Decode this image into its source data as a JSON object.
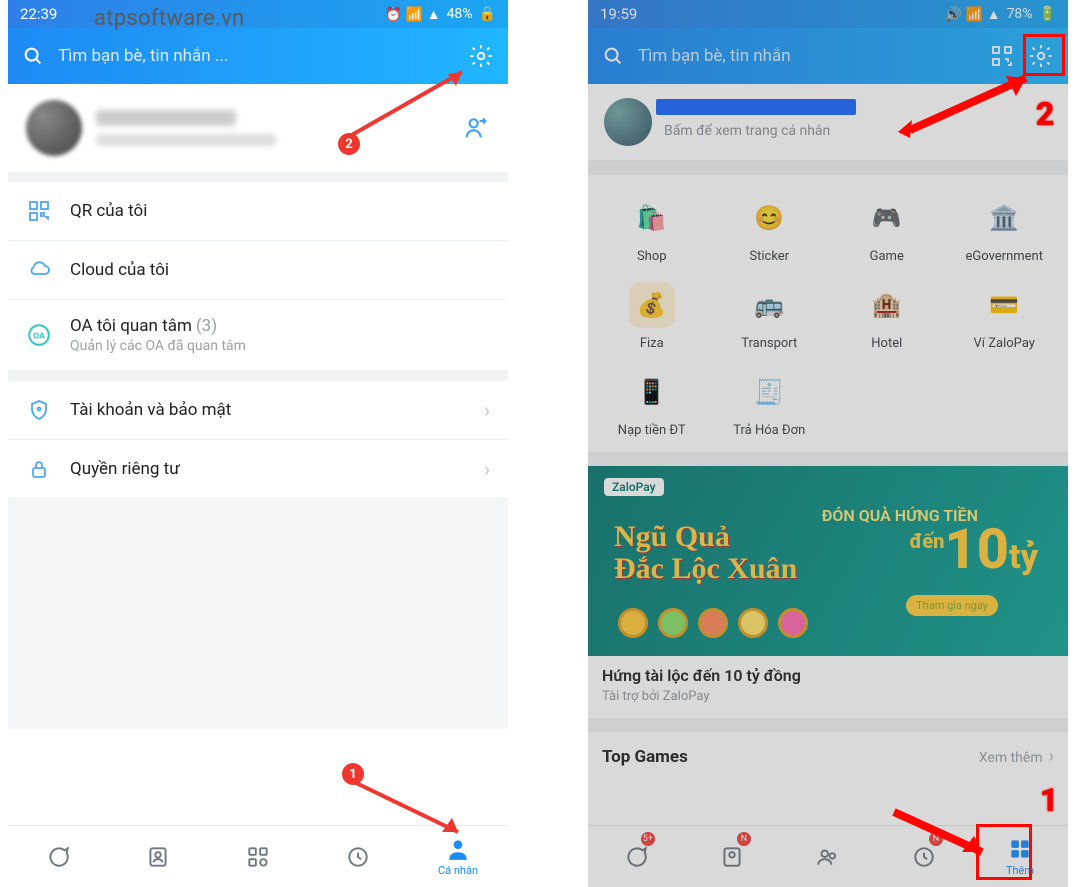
{
  "watermark": "atpsoftware.vn",
  "left": {
    "status": {
      "time": "22:39",
      "battery": "48%"
    },
    "header": {
      "placeholder": "Tìm bạn bè, tin nhắn ..."
    },
    "menu": {
      "qr": "QR của tôi",
      "cloud": "Cloud của tôi",
      "oa": "OA tôi quan tâm",
      "oa_count": "(3)",
      "oa_sub": "Quản lý các OA đã quan tâm",
      "account": "Tài khoản và bảo mật",
      "privacy": "Quyền riêng tư"
    },
    "nav": {
      "personal": "Cá nhân"
    },
    "markers": {
      "m1": "1",
      "m2": "2"
    }
  },
  "right": {
    "status": {
      "time": "19:59",
      "battery": "78%"
    },
    "header": {
      "placeholder": "Tìm bạn bè, tin nhắn"
    },
    "profile_sub": "Bấm để xem trang cá nhân",
    "grid": {
      "shop": "Shop",
      "sticker": "Sticker",
      "game": "Game",
      "egov": "eGovernment",
      "fiza": "Fiza",
      "transport": "Transport",
      "hotel": "Hotel",
      "zalopay": "Ví ZaloPay",
      "topup": "Nạp tiền ĐT",
      "bill": "Trả Hóa Đơn"
    },
    "banner": {
      "brand": "ZaloPay",
      "line1": "Ngũ Quả",
      "line2": "Đắc Lộc Xuân",
      "right_small": "ĐÓN QUÀ HỨNG TIỀN",
      "den": "đến",
      "amount": "10",
      "unit": "tỷ",
      "cta": "Tham gia ngay"
    },
    "promo": {
      "title": "Hứng tài lộc đến 10 tỷ đồng",
      "sub": "Tài trợ bởi ZaloPay"
    },
    "topgames": {
      "title": "Top Games",
      "more": "Xem thêm"
    },
    "nav": {
      "them": "Thêm"
    },
    "markers": {
      "m1": "1",
      "m2": "2"
    }
  }
}
